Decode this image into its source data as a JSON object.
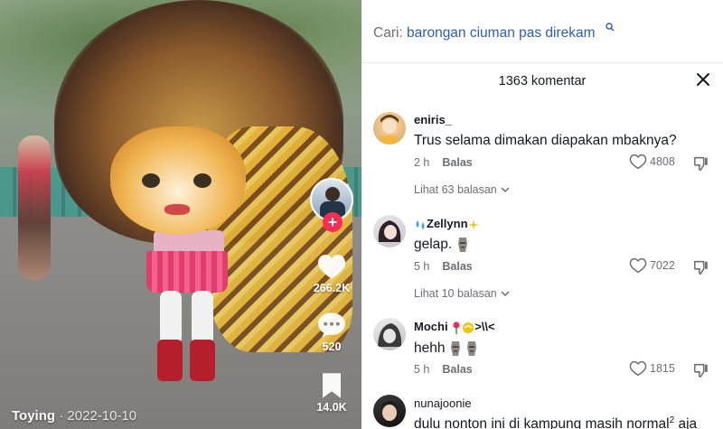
{
  "video": {
    "author": "Toying",
    "separator": " · ",
    "date": "2022-10-10",
    "actions": {
      "likes": "266.2K",
      "comments": "520",
      "saves": "14.0K"
    },
    "follow_symbol": "+"
  },
  "search": {
    "prefix": "Cari: ",
    "query": "barongan ciuman pas direkam"
  },
  "comments_panel": {
    "count_label": "1363 komentar",
    "comments": [
      {
        "username": "eniris_",
        "text": "Trus selama dimakan diapakan mbaknya?",
        "time": "2 h",
        "reply_label": "Balas",
        "likes": "4808",
        "replies_label": "Lihat 63 balasan"
      },
      {
        "username": "Zellynn",
        "text": "gelap.",
        "time": "5 h",
        "reply_label": "Balas",
        "likes": "7022",
        "replies_label": "Lihat 10 balasan"
      },
      {
        "username": "Mochi",
        "username_suffix": ">\\\\<",
        "text": "hehh",
        "time": "5 h",
        "reply_label": "Balas",
        "likes": "1815"
      },
      {
        "username": "nunajoonie",
        "text": "dulu nonton ini di kampung masih normal",
        "text_superscript": "2",
        "text_tail": " aja"
      }
    ]
  },
  "colors": {
    "accent_link": "#2b5db9",
    "follow_red": "#fe2c55",
    "text_primary": "#161823",
    "text_secondary": "#6d6e73"
  },
  "icons": [
    "search-icon",
    "close-icon",
    "heart-icon",
    "comment-icon",
    "bookmark-icon",
    "dislike-icon",
    "chevron-down-icon",
    "moai-emoji",
    "droplets-emoji",
    "sparkles-emoji",
    "rose-emoji",
    "dizzy-emoji"
  ]
}
